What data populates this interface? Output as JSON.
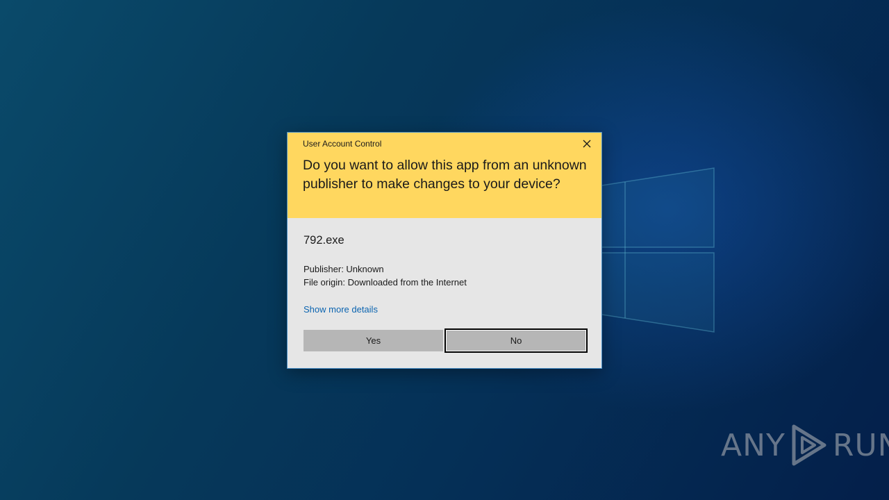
{
  "dialog": {
    "title": "User Account Control",
    "question": "Do you want to allow this app from an unknown publisher to make changes to your device?",
    "app_name": "792.exe",
    "publisher": "Publisher: Unknown",
    "file_origin": "File origin: Downloaded from the Internet",
    "details_link": "Show more details",
    "yes_label": "Yes",
    "no_label": "No",
    "close_icon": "close-icon"
  },
  "watermark": {
    "text_left": "ANY",
    "text_right": "RUN"
  },
  "colors": {
    "header": "#ffd75f",
    "body": "#e6e6e6",
    "link": "#0b64b0",
    "button": "#b6b6b6"
  }
}
